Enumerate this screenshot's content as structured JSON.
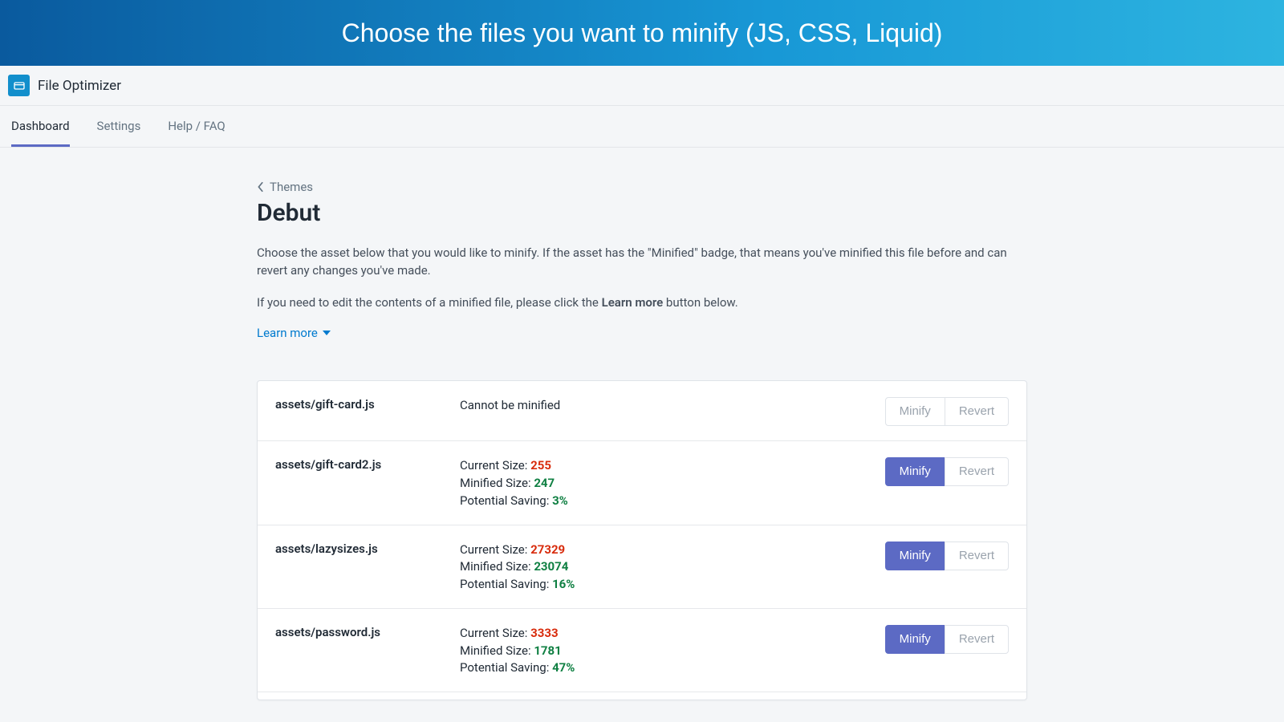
{
  "banner": {
    "text": "Choose the files you want to minify (JS, CSS, Liquid)"
  },
  "app": {
    "title": "File Optimizer"
  },
  "tabs": [
    {
      "label": "Dashboard",
      "active": true
    },
    {
      "label": "Settings",
      "active": false
    },
    {
      "label": "Help / FAQ",
      "active": false
    }
  ],
  "breadcrumb": {
    "label": "Themes"
  },
  "page_title": "Debut",
  "description1_a": "Choose the asset below that you would like to minify. If the asset has the \"Minified\" badge, that means you've minified this file before and can revert any changes you've made.",
  "description2_pre": "If you need to edit the contents of a minified file, please click the ",
  "description2_bold": "Learn more",
  "description2_post": " button below.",
  "learn_more": "Learn more",
  "labels": {
    "current_size": "Current Size: ",
    "minified_size": "Minified Size: ",
    "potential_saving": "Potential Saving: ",
    "cannot_minify": "Cannot be minified",
    "minify": "Minify",
    "revert": "Revert"
  },
  "assets": [
    {
      "file": "assets/gift-card.js",
      "status": "cannot",
      "minify_enabled": false,
      "revert_enabled": false
    },
    {
      "file": "assets/gift-card2.js",
      "current": "255",
      "minified": "247",
      "saving": "3%",
      "minify_enabled": true,
      "revert_enabled": false
    },
    {
      "file": "assets/lazysizes.js",
      "current": "27329",
      "minified": "23074",
      "saving": "16%",
      "minify_enabled": true,
      "revert_enabled": false
    },
    {
      "file": "assets/password.js",
      "current": "3333",
      "minified": "1781",
      "saving": "47%",
      "minify_enabled": true,
      "revert_enabled": false
    }
  ]
}
